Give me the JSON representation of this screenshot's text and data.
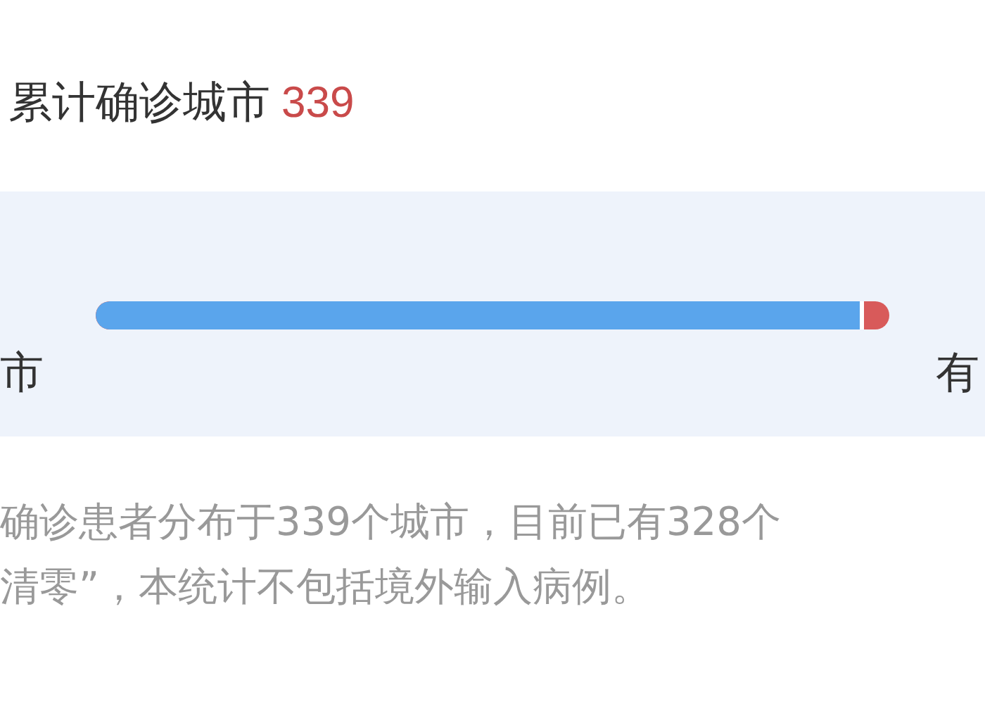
{
  "header": {
    "title": "累计确诊城市",
    "count": "339"
  },
  "bar": {
    "level": 0.968,
    "left_label": "市",
    "right_label": "有"
  },
  "caption": [
    "确诊患者分布于339个城市，目前已有328个",
    "清零”，本统计不包括境外输入病例。"
  ]
}
